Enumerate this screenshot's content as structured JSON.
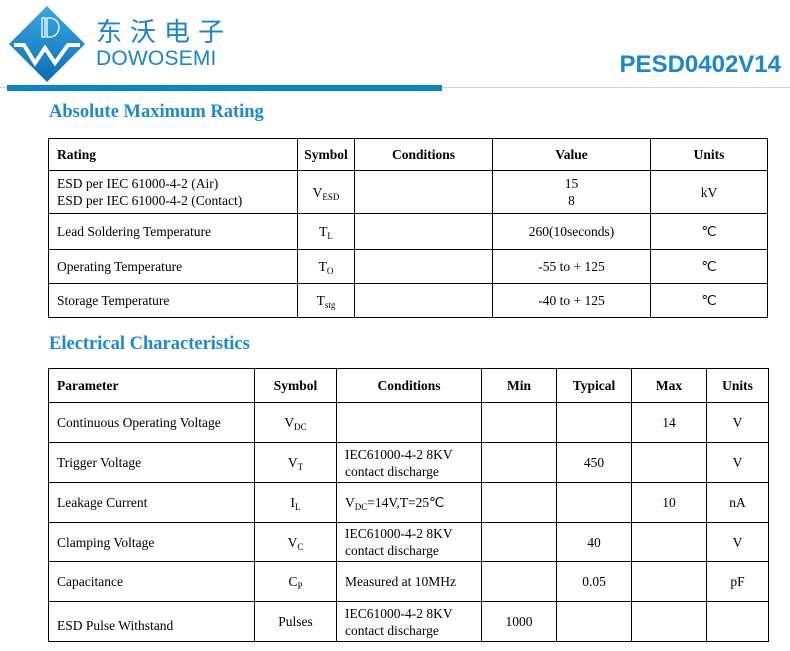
{
  "header": {
    "brand_cn": "东沃电子",
    "brand_en": "DOWOSEMI",
    "logo_letters": "DW",
    "part_number": "PESD0402V14",
    "brand_color": "#1a84cc",
    "bar_color": "#0a86cf"
  },
  "abs_max": {
    "title": "Absolute Maximum Rating",
    "headers": [
      "Rating",
      "Symbol",
      "Conditions",
      "Value",
      "Units"
    ],
    "rows": [
      {
        "rating_lines": [
          "ESD per IEC 61000-4-2 (Air)",
          "ESD per IEC 61000-4-2 (Contact)"
        ],
        "symbol": "V",
        "symbol_sub": "ESD",
        "conditions": "",
        "value_lines": [
          "15",
          "8"
        ],
        "units": "kV"
      },
      {
        "rating": "Lead Soldering Temperature",
        "symbol": "T",
        "symbol_sub": "L",
        "conditions": "",
        "value": "260(10seconds)",
        "units": "℃"
      },
      {
        "rating": "Operating Temperature",
        "symbol": "T",
        "symbol_sub": "O",
        "conditions": "",
        "value": "-55 to + 125",
        "units": "℃"
      },
      {
        "rating": "Storage Temperature",
        "symbol": "T",
        "symbol_sub": "stg",
        "conditions": "",
        "value": "-40 to + 125",
        "units": "℃"
      }
    ]
  },
  "electrical": {
    "title": "Electrical Characteristics",
    "headers": [
      "Parameter",
      "Symbol",
      "Conditions",
      "Min",
      "Typical",
      "Max",
      "Units"
    ],
    "rows": [
      {
        "parameter": "Continuous Operating Voltage",
        "symbol": "V",
        "symbol_sub": "DC",
        "conditions": "",
        "min": "",
        "typical": "",
        "max": "14",
        "units": "V"
      },
      {
        "parameter": "Trigger Voltage",
        "symbol": "V",
        "symbol_sub": "T",
        "conditions_lines": [
          "IEC61000-4-2 8KV",
          "contact discharge"
        ],
        "min": "",
        "typical": "450",
        "max": "",
        "units": "V"
      },
      {
        "parameter": "Leakage Current",
        "symbol": "I",
        "symbol_sub": "L",
        "conditions_prefix": "V",
        "conditions_sub": "DC",
        "conditions_suffix": "=14V,T=25℃",
        "min": "",
        "typical": "",
        "max": "10",
        "units": "nA"
      },
      {
        "parameter": "Clamping Voltage",
        "symbol": "V",
        "symbol_sub": "C",
        "conditions_lines": [
          "IEC61000-4-2 8KV",
          "contact discharge"
        ],
        "min": "",
        "typical": "40",
        "max": "",
        "units": "V"
      },
      {
        "parameter": "Capacitance",
        "symbol": "C",
        "symbol_sub": "P",
        "conditions": "Measured at 10MHz",
        "min": "",
        "typical": "0.05",
        "max": "",
        "units": "pF"
      },
      {
        "parameter": "ESD Pulse Withstand",
        "symbol": "Pulses",
        "conditions_lines": [
          "IEC61000-4-2 8KV",
          "contact discharge"
        ],
        "min": "1000",
        "typical": "",
        "max": "",
        "units": ""
      }
    ]
  }
}
